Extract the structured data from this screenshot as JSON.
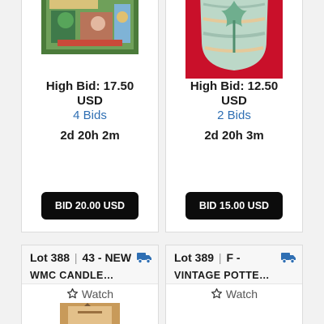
{
  "cards": [
    {
      "high_bid": "High Bid: 17.50",
      "currency": "USD",
      "bids": "4 Bids",
      "time_left": "2d 20h 2m",
      "button": "BID 20.00 USD"
    },
    {
      "high_bid": "High Bid: 12.50",
      "currency": "USD",
      "bids": "2 Bids",
      "time_left": "2d 20h 3m",
      "button": "BID 15.00 USD"
    }
  ],
  "lots": [
    {
      "lot": "Lot 388",
      "sep": "|",
      "title_line1": "43 - NEW",
      "title_line2": "WMC CANDLE…",
      "watch": "Watch"
    },
    {
      "lot": "Lot 389",
      "sep": "|",
      "title_line1": "F -",
      "title_line2": "VINTAGE POTTE…",
      "watch": "Watch"
    }
  ],
  "colors": {
    "link": "#2f6fb3",
    "truck": "#2f6fb3",
    "button_bg": "#0c0c0c"
  }
}
